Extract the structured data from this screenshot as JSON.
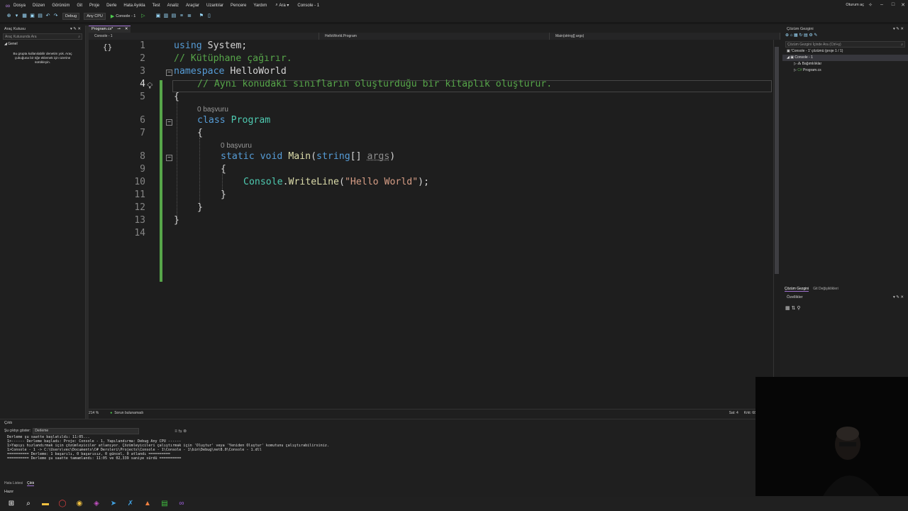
{
  "menu": {
    "items": [
      "Dosya",
      "Düzen",
      "Görünüm",
      "Git",
      "Proje",
      "Derle",
      "Hata Ayıkla",
      "Test",
      "Analiz",
      "Araçlar",
      "Uzantılar",
      "Pencere",
      "Yardım"
    ],
    "search_label": "Ara",
    "solution_name": "Console - 1",
    "user_label": "Oturum aç"
  },
  "toolbar": {
    "config": "Debug",
    "platform": "Any CPU",
    "start_label": "Console - 1"
  },
  "toolbox": {
    "title": "Araç Kutusu",
    "search_placeholder": "Araç Kutusunda Ara",
    "group": "Genel",
    "empty_text": "Bu grupta kullanılabilir denetim yok. Araç çubuğuna bir öğe eklemek için üzerine sürükleyin."
  },
  "editor": {
    "tab_label": "Program.cs*",
    "nav_project": "Console - 1",
    "nav_class": "HelloWorld.Program",
    "nav_member": "Main(string[] args)",
    "references_1": "0 başvuru",
    "references_2": "0 başvuru",
    "lines": {
      "l1_kw": "using",
      "l1_rest": " System;",
      "l2": "// Kütüphane çağırır.",
      "l3_kw": "namespace",
      "l3_rest": " HelloWorld",
      "l4": "// Aynı konudaki sınıfların oluşturduğu bir kitaplık oluşturur.",
      "l5": "{",
      "l6_kw": "class",
      "l6_rest": "Program",
      "l7": "{",
      "l8_kw1": "static",
      "l8_kw2": "void",
      "l8_fn": "Main",
      "l8_p1": "(",
      "l8_kw3": "string",
      "l8_p2": "[] ",
      "l8_prm": "args",
      "l8_p3": ")",
      "l9": "{",
      "l10_ty": "Console",
      "l10_dot": ".",
      "l10_fn": "WriteLine",
      "l10_p1": "(",
      "l10_st": "\"Hello World\"",
      "l10_p2": ");",
      "l11": "}",
      "l12": "}",
      "l13": "}"
    },
    "line_numbers": [
      "1",
      "2",
      "3",
      "4",
      "5",
      "6",
      "7",
      "8",
      "9",
      "10",
      "11",
      "12",
      "13",
      "14"
    ]
  },
  "editor_status": {
    "zoom": "214 %",
    "issues": "Sorun bulunamadı",
    "line": "Sat: 4",
    "col": "Krkt: 68"
  },
  "solution_explorer": {
    "title": "Çözüm Gezgini",
    "search_placeholder": "Çözüm Gezgini İçinde Ara (Ctrl+ş)",
    "solution": "'Console - 1' çözümü (proje 1 / 1)",
    "project": "Console - 1",
    "deps": "Bağımlılıklar",
    "file": "Program.cs",
    "tab1": "Çözüm Gezgini",
    "tab2": "Git Değişiklikleri"
  },
  "properties": {
    "title": "Özellikler"
  },
  "output": {
    "title": "Çıktı",
    "show_label": "Şu çıktıyı göster:",
    "source": "Derleme",
    "lines": [
      "Derleme şu saatte başlatıldı: 11:05...",
      "1>------ Derleme başladı: Proje: Console - 1, Yapılandırma: Debug Any CPU ------",
      "1>Yapıyı hızlandırmak için çözümleyiciler atlanıyor. Çözümleyicileri çalıştırmak için 'Oluştur' veya 'Yeniden Oluştur' komutunu çalıştırabilirsiniz.",
      "1>Console - 1 -> C:\\Users\\vec\\Documents\\C# Dersleri\\Projects\\Console - 1\\Console - 1\\bin\\Debug\\net8.0\\Console - 1.dll",
      "========== Derleme: 1 başarılı, 0 başarısız, 0 güncel, 0 atlandı ==========",
      "========== Derleme şu saatte tamamlandı: 11:05 ve 02,339 saniye sürdü =========="
    ],
    "tab1": "Hata Listesi",
    "tab2": "Çıktı"
  },
  "statusbar": {
    "text": "Hazır"
  },
  "colors": {
    "accent": "#a173d1",
    "keyword": "#569cd6",
    "comment": "#57a64a",
    "type": "#4ec9b0",
    "method": "#dcdcaa",
    "string": "#d69d85"
  }
}
